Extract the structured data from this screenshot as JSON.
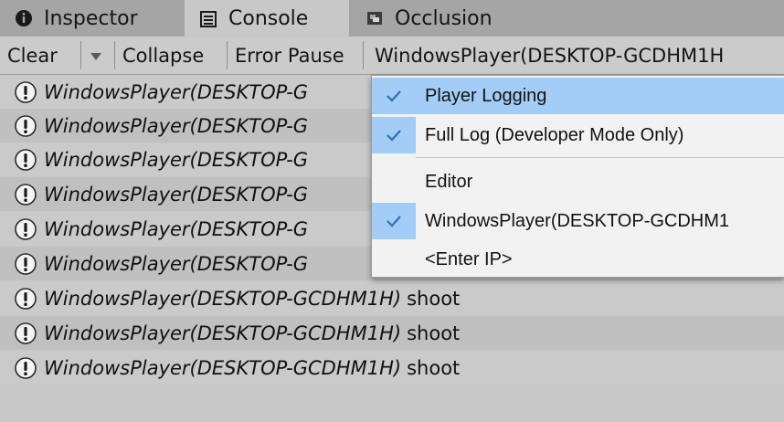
{
  "tabs": [
    {
      "label": "Inspector",
      "icon": "info-icon",
      "active": false
    },
    {
      "label": "Console",
      "icon": "console-icon",
      "active": true
    },
    {
      "label": "Occlusion",
      "icon": "occlusion-icon",
      "active": false
    }
  ],
  "toolbar": {
    "clear_label": "Clear",
    "clear_dropdown_icon": "triangle-down-icon",
    "collapse_label": "Collapse",
    "error_pause_label": "Error Pause",
    "player_label": "WindowsPlayer(DESKTOP-GCDHM1H"
  },
  "log_rows": [
    {
      "source": "WindowsPlayer(DESKTOP-G",
      "message": ""
    },
    {
      "source": "WindowsPlayer(DESKTOP-G",
      "message": ""
    },
    {
      "source": "WindowsPlayer(DESKTOP-G",
      "message": ""
    },
    {
      "source": "WindowsPlayer(DESKTOP-G",
      "message": ""
    },
    {
      "source": "WindowsPlayer(DESKTOP-G",
      "message": ""
    },
    {
      "source": "WindowsPlayer(DESKTOP-G",
      "message": ""
    },
    {
      "source": "WindowsPlayer(DESKTOP-GCDHM1H)",
      "message": "shoot"
    },
    {
      "source": "WindowsPlayer(DESKTOP-GCDHM1H)",
      "message": "shoot"
    },
    {
      "source": "WindowsPlayer(DESKTOP-GCDHM1H)",
      "message": "shoot"
    }
  ],
  "dropdown": {
    "items": [
      {
        "label": "Player Logging",
        "checked": true,
        "highlighted": true
      },
      {
        "label": "Full Log (Developer Mode Only)",
        "checked": true,
        "highlighted": false
      },
      {
        "label": "Editor",
        "checked": false,
        "highlighted": false
      },
      {
        "label": "WindowsPlayer(DESKTOP-GCDHM1",
        "checked": true,
        "highlighted": false
      },
      {
        "label": "<Enter IP>",
        "checked": false,
        "highlighted": false
      }
    ]
  },
  "colors": {
    "highlight": "#a3cdf6",
    "checkmark": "#2e6fb8",
    "tabbar": "#a5a5a5",
    "panel": "#c8c8c8"
  }
}
